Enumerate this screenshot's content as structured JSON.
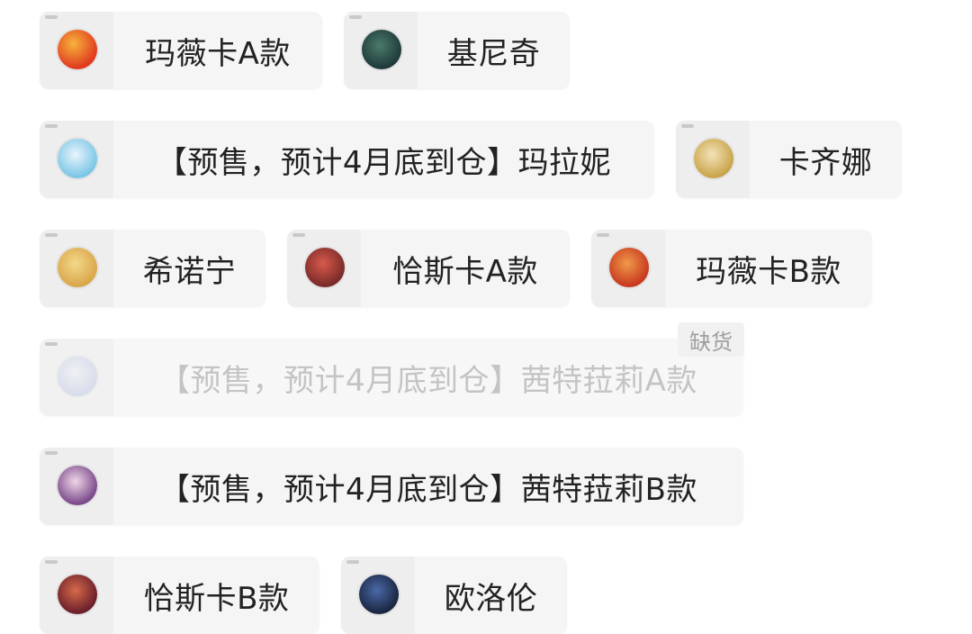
{
  "options": [
    {
      "label": "玛薇卡A款",
      "avatar": "mavuika-avatar-icon",
      "colors": [
        "#e03a1f",
        "#f7b33b"
      ]
    },
    {
      "label": "基尼奇",
      "avatar": "kinich-avatar-icon",
      "colors": [
        "#1f3a3a",
        "#4a7a6a"
      ]
    },
    {
      "label": "【预售，预计4月底到仓】玛拉妮",
      "avatar": "mualani-avatar-icon",
      "colors": [
        "#7ac6e6",
        "#e9f4fb"
      ]
    },
    {
      "label": "卡齐娜",
      "avatar": "kachina-avatar-icon",
      "colors": [
        "#c9a44a",
        "#f3e2b8"
      ]
    },
    {
      "label": "希诺宁",
      "avatar": "xilonen-avatar-icon",
      "colors": [
        "#d9a64a",
        "#f3d88a"
      ]
    },
    {
      "label": "恰斯卡A款",
      "avatar": "chasca-avatar-icon",
      "colors": [
        "#7a2a2a",
        "#d75a4a"
      ]
    },
    {
      "label": "玛薇卡B款",
      "avatar": "mavuika-b-avatar-icon",
      "colors": [
        "#c8381f",
        "#f09a4a"
      ]
    },
    {
      "label": "【预售，预计4月底到仓】茜特菈莉A款",
      "avatar": "citlali-avatar-icon",
      "colors": [
        "#a9b9e0",
        "#eef0f8"
      ],
      "disabled": true,
      "badge": "缺货"
    },
    {
      "label": "【预售，预计4月底到仓】茜特菈莉B款",
      "avatar": "citlali-b-avatar-icon",
      "colors": [
        "#7a4a8a",
        "#f0d6e8"
      ]
    },
    {
      "label": "恰斯卡B款",
      "avatar": "chasca-b-avatar-icon",
      "colors": [
        "#6a1f2a",
        "#d66a4a"
      ]
    },
    {
      "label": "欧洛伦",
      "avatar": "ororon-avatar-icon",
      "colors": [
        "#1a2540",
        "#4a6aa8"
      ]
    }
  ]
}
